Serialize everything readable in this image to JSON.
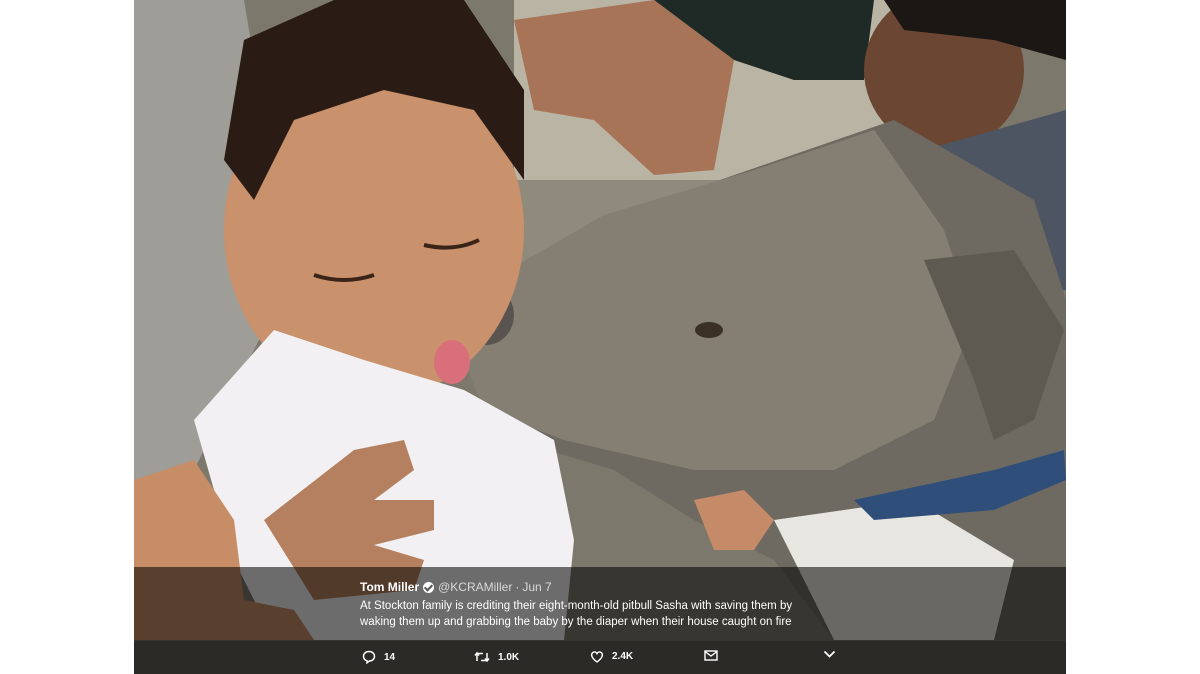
{
  "tweet": {
    "author_name": "Tom Miller",
    "handle": "@KCRAMiller",
    "separator": "·",
    "date": "Jun 7",
    "text_line1": "At Stockton family is crediting their eight-month-old pitbull Sasha with saving them by",
    "text_line2": "waking them up and grabbing the baby by the diaper when their house caught on fire"
  },
  "actions": {
    "reply_count": "14",
    "retweet_count": "1.0K",
    "like_count": "2.4K"
  },
  "icons": {
    "reply": "reply-icon",
    "retweet": "retweet-icon",
    "like": "heart-icon",
    "message": "envelope-icon",
    "more": "chevron-down-icon",
    "verified": "verified-badge-icon"
  },
  "colors": {
    "overlay": "rgba(0,0,0,0.55)",
    "action_bar": "#2c2a26",
    "text": "#ffffff"
  }
}
